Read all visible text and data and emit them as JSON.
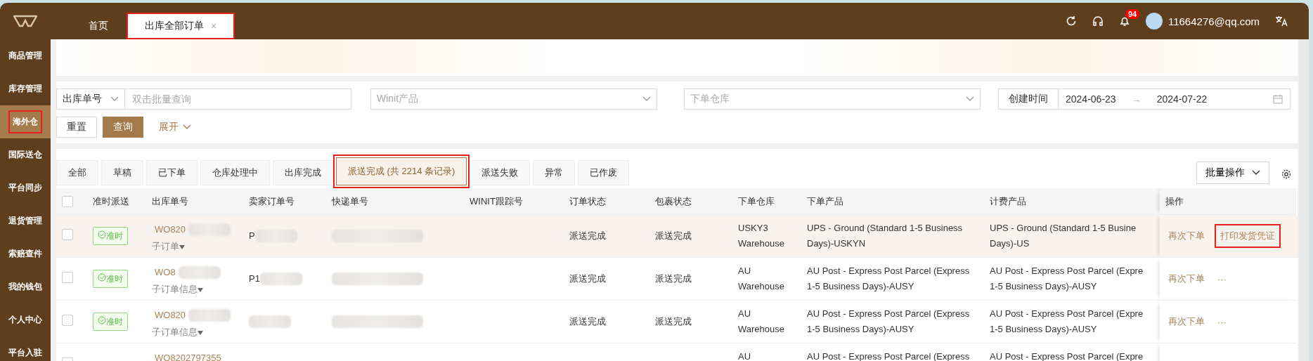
{
  "top_bar": {
    "tabs": [
      {
        "label": "首页",
        "selected": false,
        "highlighted": false
      },
      {
        "label": "出库全部订单",
        "selected": true,
        "highlighted": true,
        "close": "×"
      }
    ],
    "notification_count": "94",
    "user": "11664276@qq.com"
  },
  "sidebar": {
    "items": [
      {
        "label": "商品管理",
        "selected": false,
        "highlighted": false
      },
      {
        "label": "库存管理",
        "selected": false,
        "highlighted": false
      },
      {
        "label": "海外仓",
        "selected": true,
        "highlighted": true
      },
      {
        "label": "国际送仓",
        "selected": false,
        "highlighted": false
      },
      {
        "label": "平台同步",
        "selected": false,
        "highlighted": false
      },
      {
        "label": "退货管理",
        "selected": false,
        "highlighted": false
      },
      {
        "label": "索赔查件",
        "selected": false,
        "highlighted": false
      },
      {
        "label": "我的钱包",
        "selected": false,
        "highlighted": false
      },
      {
        "label": "个人中心",
        "selected": false,
        "highlighted": false
      },
      {
        "label": "平台入驻",
        "selected": false,
        "highlighted": false
      }
    ]
  },
  "filters": {
    "search_type": "出库单号",
    "search_placeholder": "双击批量查询",
    "product_placeholder": "Winit产品",
    "warehouse_placeholder": "下单仓库",
    "date_label": "创建时间",
    "date_from": "2024-06-23",
    "date_arrow": "→",
    "date_to": "2024-07-22",
    "buttons": [
      {
        "label": "重置",
        "kind": "default"
      },
      {
        "label": "查询",
        "kind": "primary"
      }
    ],
    "expand": "展开"
  },
  "status_tabs": [
    {
      "label": "全部",
      "selected": false,
      "highlighted": false
    },
    {
      "label": "草稿",
      "selected": false,
      "highlighted": false
    },
    {
      "label": "已下单",
      "selected": false,
      "highlighted": false
    },
    {
      "label": "仓库处理中",
      "selected": false,
      "highlighted": false
    },
    {
      "label": "出库完成",
      "selected": false,
      "highlighted": false
    },
    {
      "label": "派送完成 (共 2214 条记录)",
      "selected": true,
      "highlighted": true
    },
    {
      "label": "派送失败",
      "selected": false,
      "highlighted": false
    },
    {
      "label": "异常",
      "selected": false,
      "highlighted": false
    },
    {
      "label": "已作废",
      "selected": false,
      "highlighted": false
    }
  ],
  "batch_button": "批量操作",
  "table": {
    "select_all_checked": false,
    "columns": [
      "准时派送",
      "出库单号",
      "卖家订单号",
      "快递单号",
      "WINIT跟踪号",
      "订单状态",
      "包裹状态",
      "下单仓库",
      "下单产品",
      "计费产品",
      "操作"
    ],
    "rows": [
      {
        "selected": false,
        "hovered": true,
        "masked": true,
        "on_time": "准时",
        "order_no": "WO820",
        "sub_order": "子订单",
        "seller_order": "P",
        "order_status": "派送完成",
        "parcel_status": "派送完成",
        "warehouse": [
          "USKY3",
          "Warehouse"
        ],
        "product": [
          "UPS - Ground (Standard 1-5 Business",
          "Days)-USKYN"
        ],
        "billing": [
          "UPS - Ground (Standard 1-5 Busine",
          "Days)-US"
        ],
        "actions": [
          {
            "label": "再次下单",
            "highlighted": false
          },
          {
            "label": "打印发货凭证",
            "highlighted": true
          }
        ]
      },
      {
        "selected": false,
        "hovered": false,
        "masked": true,
        "on_time": "准时",
        "order_no": "WO8",
        "sub_order": "子订单信息",
        "seller_order": "P1",
        "order_status": "派送完成",
        "parcel_status": "派送完成",
        "warehouse": [
          "AU",
          "Warehouse"
        ],
        "product": [
          "AU Post - Express Post Parcel (Express",
          "1-5 Business Days)-AUSY"
        ],
        "billing": [
          "AU Post - Express Post Parcel (Expre",
          "1-5 Business Days)-AUSY"
        ],
        "actions": [
          {
            "label": "再次下单",
            "highlighted": false
          },
          {
            "label": "···",
            "highlighted": false
          }
        ]
      },
      {
        "selected": false,
        "hovered": false,
        "masked": true,
        "on_time": "准时",
        "order_no": "WO820",
        "sub_order": "子订单信息",
        "order_status": "派送完成",
        "parcel_status": "派送完成",
        "warehouse": [
          "AU",
          "Warehouse"
        ],
        "product": [
          "AU Post - Express Post Parcel (Express",
          "1-5 Business Days)-AUSY"
        ],
        "billing": [
          "AU Post - Express Post Parcel (Expre",
          "1-5 Business Days)-AUSY"
        ],
        "actions": [
          {
            "label": "再次下单",
            "highlighted": false
          },
          {
            "label": "···",
            "highlighted": false
          }
        ]
      },
      {
        "selected": false,
        "hovered": false,
        "masked": false,
        "order_no": "WO8202797355",
        "warehouse": [
          "AU"
        ],
        "product": [
          "AU Post - Express Post Parcel (Express"
        ],
        "billing": [
          "AU Post - Express Post Parcel (Expre"
        ],
        "actions": []
      }
    ]
  }
}
